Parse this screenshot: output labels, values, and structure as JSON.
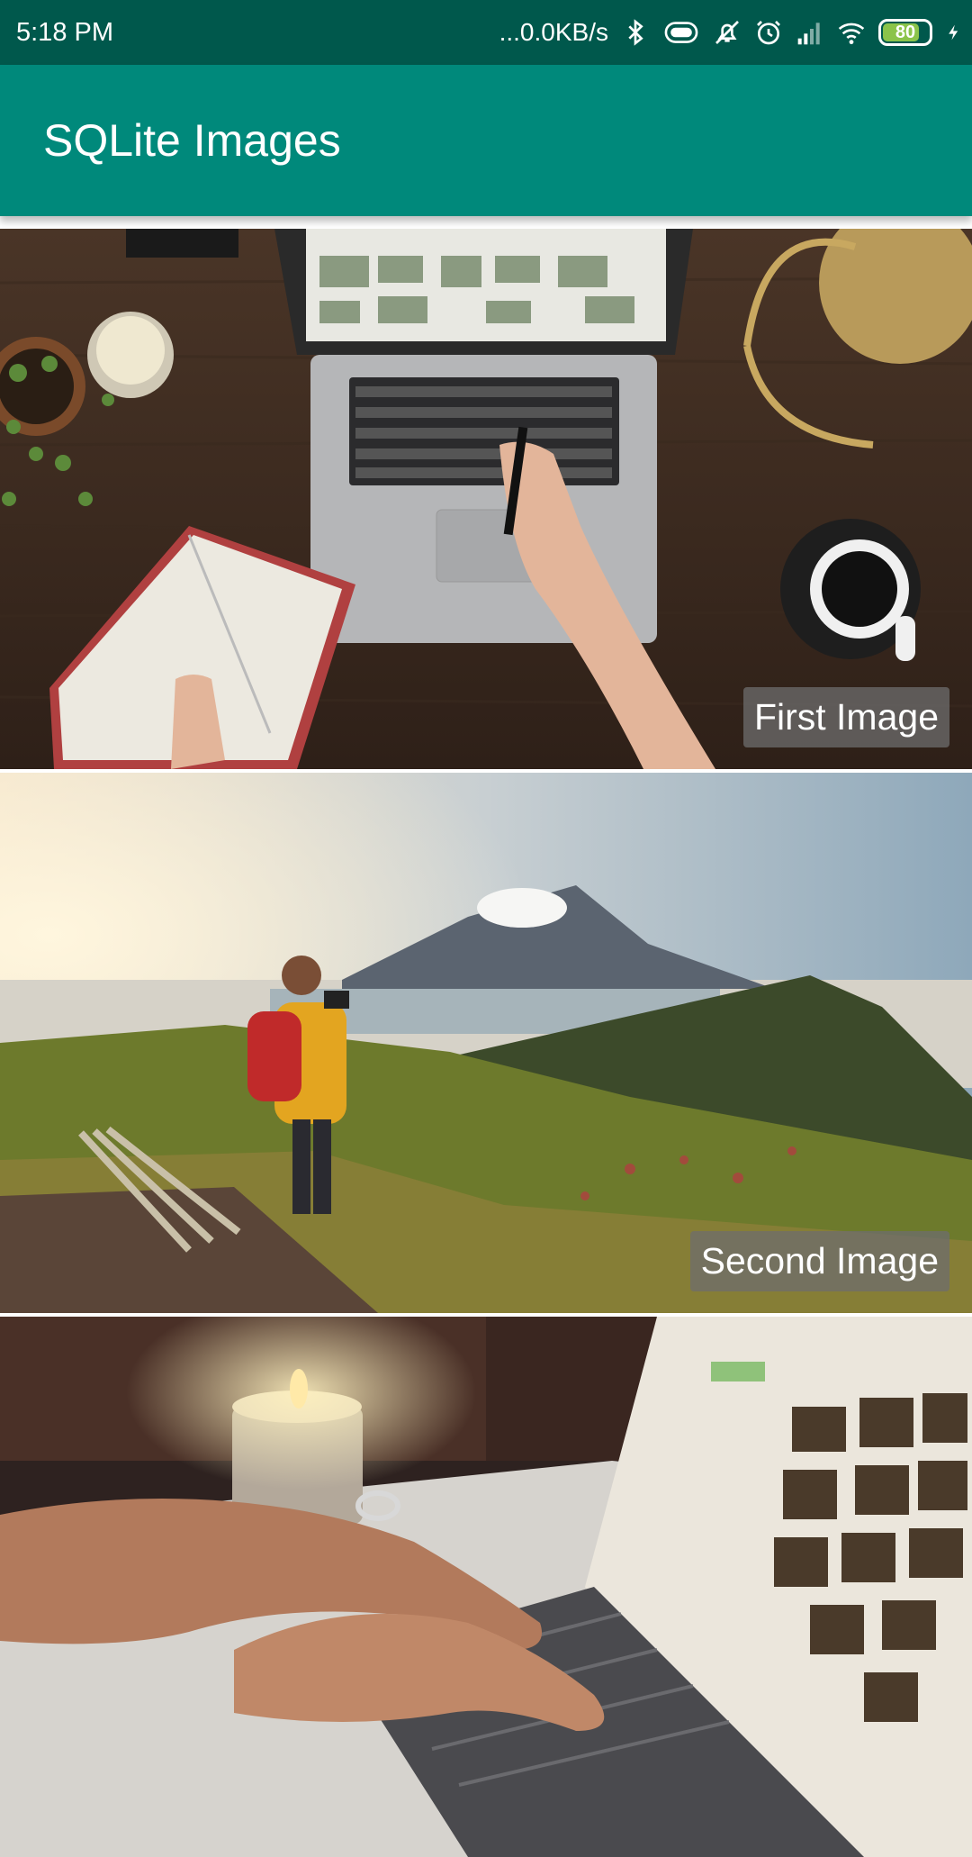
{
  "status_bar": {
    "time": "5:18 PM",
    "network_speed": "...0.0KB/s",
    "battery_level": "80",
    "battery_fraction": 0.8,
    "icons": [
      "bluetooth-icon",
      "vibrate-icon",
      "alarm-off-icon",
      "alarm-clock-icon",
      "cell-signal-icon",
      "wifi-icon",
      "battery-icon",
      "charging-icon"
    ]
  },
  "app_bar": {
    "title": "SQLite Images",
    "color": "#00897b"
  },
  "images": [
    {
      "caption": "First Image",
      "scene": "laptop on wooden desk with notebook and coffee"
    },
    {
      "caption": "Second Image",
      "scene": "hiker with camera on mountain"
    },
    {
      "caption": "",
      "scene": "hands typing on laptop with candle"
    }
  ]
}
